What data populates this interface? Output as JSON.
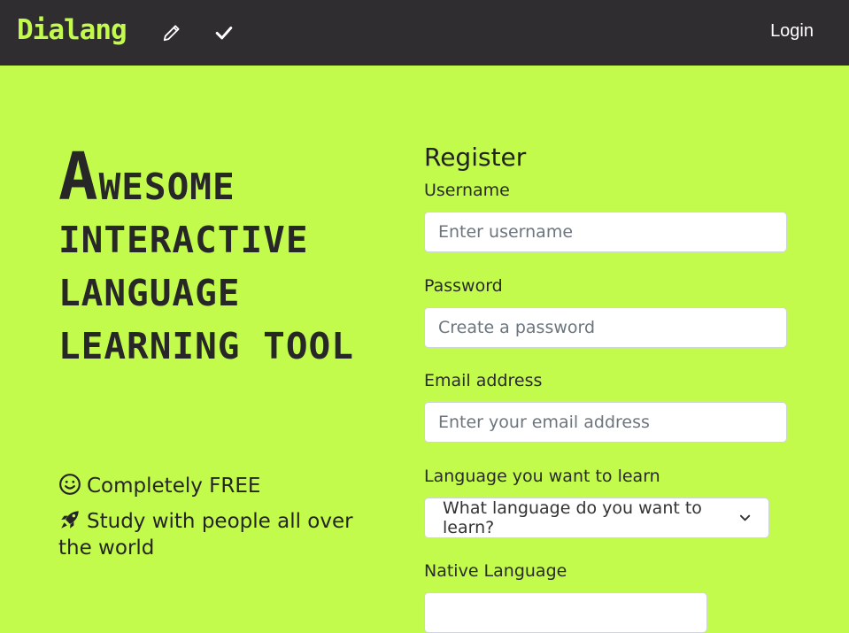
{
  "navbar": {
    "brand": "Dialang",
    "icons": [
      "pencil-icon",
      "check-icon"
    ],
    "login_label": "Login"
  },
  "hero": {
    "heading": "Awesome interactive language learning tool"
  },
  "features": [
    {
      "icon": "smile-icon",
      "text": "Completely FREE"
    },
    {
      "icon": "rocket-icon",
      "text": "Study with people all over the world"
    }
  ],
  "register": {
    "title": "Register",
    "username_label": "Username",
    "username_placeholder": "Enter username",
    "password_label": "Password",
    "password_placeholder": "Create a password",
    "email_label": "Email address",
    "email_placeholder": "Enter your email address",
    "learn_language_label": "Language you want to learn",
    "learn_language_value": "What language do you want to learn?",
    "native_language_label": "Native Language"
  },
  "colors": {
    "accent": "#c2fb4b",
    "navbar": "#2f2d2f",
    "text": "#272727"
  }
}
